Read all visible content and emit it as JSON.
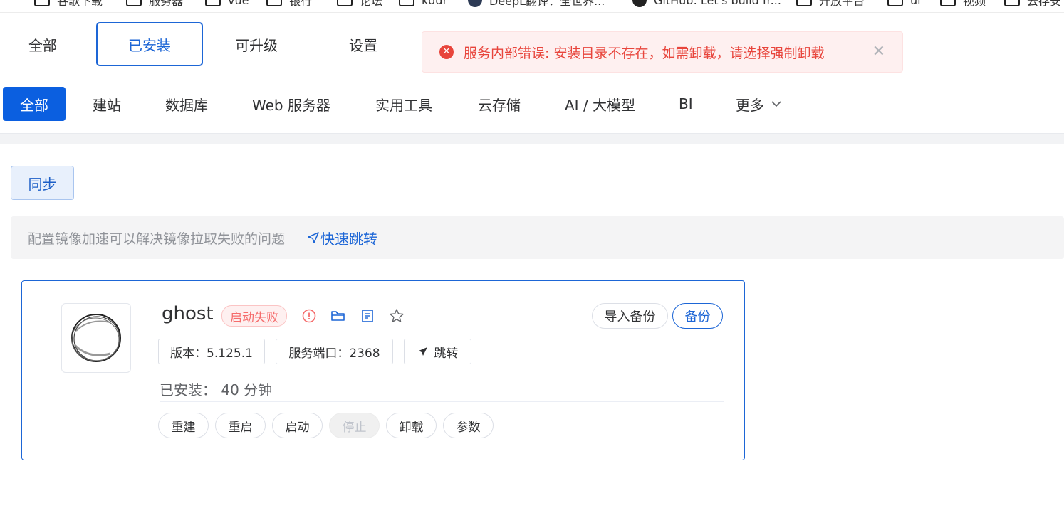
{
  "bookmarks": [
    {
      "label": "谷歌下载"
    },
    {
      "label": "服务器"
    },
    {
      "label": "vue"
    },
    {
      "label": "银行"
    },
    {
      "label": "论坛"
    },
    {
      "label": "kddr"
    },
    {
      "label": "DeepL翻译：全世界..."
    },
    {
      "label": "GitHub: Let's build fr..."
    },
    {
      "label": "开放平台"
    },
    {
      "label": "ui"
    },
    {
      "label": "视频"
    },
    {
      "label": "云存安"
    }
  ],
  "top_tabs": [
    {
      "label": "全部"
    },
    {
      "label": "已安装"
    },
    {
      "label": "可升级"
    },
    {
      "label": "设置"
    }
  ],
  "alert": {
    "message": "服务内部错误: 安装目录不存在，如需卸载，请选择强制卸载",
    "icon": "error-circle-icon",
    "close_icon": "close-icon",
    "color": "#e8453c"
  },
  "categories": [
    {
      "label": "全部"
    },
    {
      "label": "建站"
    },
    {
      "label": "数据库"
    },
    {
      "label": "Web 服务器"
    },
    {
      "label": "实用工具"
    },
    {
      "label": "云存储"
    },
    {
      "label": "AI / 大模型"
    },
    {
      "label": "BI"
    },
    {
      "label": "更多"
    }
  ],
  "sync_label": "同步",
  "tip": {
    "text": "配置镜像加速可以解决镜像拉取失败的问题",
    "link": "快速跳转"
  },
  "app": {
    "name": "ghost",
    "status": "启动失败",
    "icons": [
      "warning-icon",
      "folder-icon",
      "document-icon",
      "star-icon"
    ],
    "import_backup": "导入备份",
    "backup": "备份",
    "version": "版本：5.125.1",
    "port": "服务端口：2368",
    "jump": "跳转",
    "installed": "已安装：  40 分钟",
    "actions": [
      {
        "label": "重建"
      },
      {
        "label": "重启"
      },
      {
        "label": "启动"
      },
      {
        "label": "停止"
      },
      {
        "label": "卸载"
      },
      {
        "label": "参数"
      }
    ]
  },
  "colors": {
    "primary": "#1d66d6",
    "danger": "#f56c6c"
  }
}
